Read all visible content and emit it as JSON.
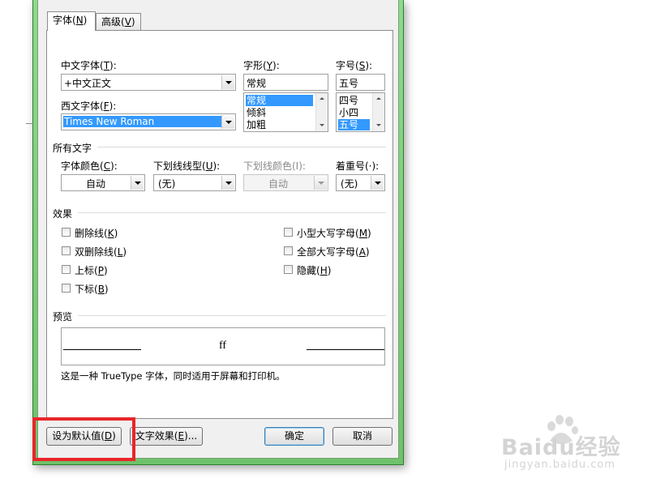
{
  "tabs": [
    {
      "label": "字体(",
      "key": "N",
      "suffix": ")"
    },
    {
      "label": "高级(",
      "key": "V",
      "suffix": ")"
    }
  ],
  "font": {
    "cn_font": {
      "label": "中文字体(",
      "key": "T",
      "suffix": "):",
      "value": "+中文正文"
    },
    "west_font": {
      "label": "西文字体(",
      "key": "F",
      "suffix": "):",
      "value": "Times New Roman"
    },
    "style": {
      "label": "字形(",
      "key": "Y",
      "suffix": "):",
      "value": "常规",
      "options": [
        "常规",
        "倾斜",
        "加粗"
      ],
      "selected": 0
    },
    "size": {
      "label": "字号(",
      "key": "S",
      "suffix": "):",
      "value": "五号",
      "options": [
        "四号",
        "小四",
        "五号"
      ],
      "selected": 2
    }
  },
  "all_text": {
    "heading": "所有文字",
    "color": {
      "label": "字体颜色(",
      "key": "C",
      "suffix": "):",
      "value": "自动"
    },
    "underline_style": {
      "label": "下划线线型(",
      "key": "U",
      "suffix": "):",
      "value": "(无)"
    },
    "underline_color": {
      "label": "下划线颜色(I):",
      "value": "自动"
    },
    "emphasis": {
      "label": "着重号(·):",
      "value": "(无)"
    }
  },
  "effects": {
    "heading": "效果",
    "left": [
      {
        "label": "删除线(",
        "key": "K",
        "suffix": ")"
      },
      {
        "label": "双删除线(",
        "key": "L",
        "suffix": ")"
      },
      {
        "label": "上标(",
        "key": "P",
        "suffix": ")"
      },
      {
        "label": "下标(",
        "key": "B",
        "suffix": ")"
      }
    ],
    "right": [
      {
        "label": "小型大写字母(",
        "key": "M",
        "suffix": ")"
      },
      {
        "label": "全部大写字母(",
        "key": "A",
        "suffix": ")"
      },
      {
        "label": "隐藏(",
        "key": "H",
        "suffix": ")"
      }
    ]
  },
  "preview": {
    "heading": "预览",
    "sample": "ff",
    "note": "这是一种 TrueType 字体，同时适用于屏幕和打印机。"
  },
  "buttons": {
    "default": {
      "label": "设为默认值(",
      "key": "D",
      "suffix": ")"
    },
    "text_effects": {
      "label": "文字效果(",
      "key": "E",
      "suffix": ")..."
    },
    "ok": "确定",
    "cancel": "取消"
  },
  "watermark": {
    "brand": "Baidu经验",
    "url": "jingyan.baidu.com"
  },
  "colors": {
    "highlight": "#3399ff",
    "frame": "#7ccf77",
    "annotation": "#e8262a"
  }
}
